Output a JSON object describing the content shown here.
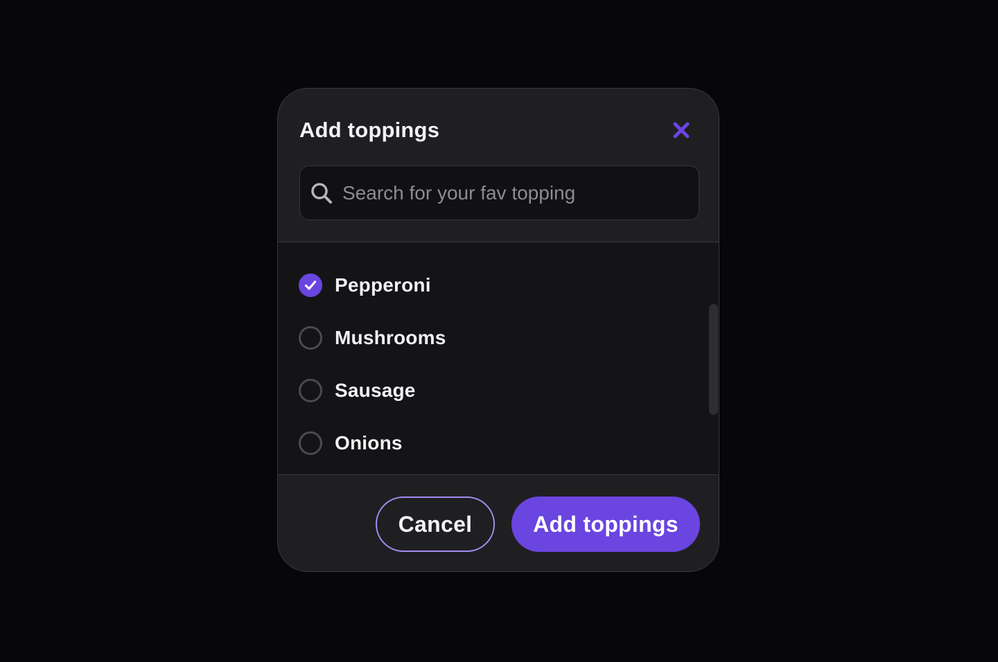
{
  "dialog": {
    "title": "Add toppings",
    "close_icon": "close-icon",
    "accent_color": "#6a45e0"
  },
  "search": {
    "icon": "search-icon",
    "placeholder": "Search for your fav topping",
    "value": ""
  },
  "toppings": [
    {
      "label": "Pepperoni",
      "checked": true
    },
    {
      "label": "Mushrooms",
      "checked": false
    },
    {
      "label": "Sausage",
      "checked": false
    },
    {
      "label": "Onions",
      "checked": false
    }
  ],
  "footer": {
    "cancel_label": "Cancel",
    "submit_label": "Add toppings"
  }
}
